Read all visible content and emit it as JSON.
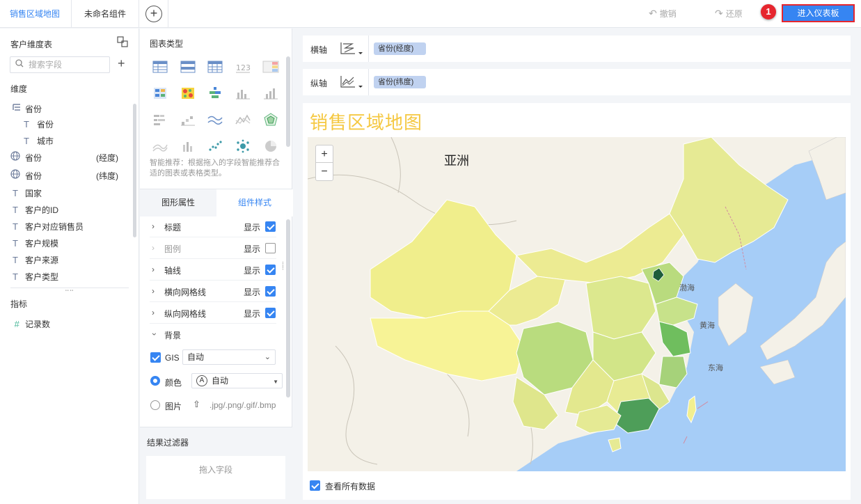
{
  "topbar": {
    "tabs": [
      {
        "label": "销售区域地图",
        "active": true
      },
      {
        "label": "未命名组件",
        "active": false
      }
    ],
    "add_tab_symbol": "+",
    "undo_label": "撤销",
    "redo_label": "还原",
    "step_badge": "1",
    "enter_dashboard_label": "进入仪表板"
  },
  "left_panel": {
    "table_name": "客户维度表",
    "search_placeholder": "搜索字段",
    "dimension_label": "维度",
    "dimensions": [
      {
        "icon": "tree-icon",
        "name": "省份",
        "suffix": ""
      },
      {
        "icon": "text-icon",
        "name": "省份",
        "suffix": ""
      },
      {
        "icon": "text-icon",
        "name": "城市",
        "suffix": ""
      },
      {
        "icon": "globe-icon",
        "name": "省份",
        "suffix": "(经度)"
      },
      {
        "icon": "globe-icon",
        "name": "省份",
        "suffix": "(纬度)"
      },
      {
        "icon": "text-icon",
        "name": "国家",
        "suffix": ""
      },
      {
        "icon": "text-icon",
        "name": "客户的ID",
        "suffix": ""
      },
      {
        "icon": "text-icon",
        "name": "客户对应销售员",
        "suffix": ""
      },
      {
        "icon": "text-icon",
        "name": "客户规模",
        "suffix": ""
      },
      {
        "icon": "text-icon",
        "name": "客户来源",
        "suffix": ""
      },
      {
        "icon": "text-icon",
        "name": "客户类型",
        "suffix": ""
      }
    ],
    "measure_label": "指标",
    "measures": [
      {
        "icon": "hash-icon",
        "name": "记录数"
      }
    ]
  },
  "middle_panel": {
    "chart_type_title": "图表类型",
    "smart_hint": "智能推荐：根据拖入的字段智能推荐合适的图表或表格类型。",
    "property_tabs": [
      "图形属性",
      "组件样式"
    ],
    "property_rows": [
      {
        "label": "标题",
        "state_label": "显示",
        "checked": true,
        "dim": false
      },
      {
        "label": "图例",
        "state_label": "显示",
        "checked": false,
        "dim": true
      },
      {
        "label": "轴线",
        "state_label": "显示",
        "checked": true,
        "dim": false
      },
      {
        "label": "横向网格线",
        "state_label": "显示",
        "checked": true,
        "dim": false
      },
      {
        "label": "纵向网格线",
        "state_label": "显示",
        "checked": true,
        "dim": false
      }
    ],
    "background": {
      "label": "背景",
      "gis_label": "GIS",
      "gis_value": "自动",
      "color_label": "颜色",
      "color_value": "自动",
      "image_label": "图片",
      "image_formats": ".jpg/.png/.gif/.bmp"
    },
    "filter_title": "结果过滤器",
    "filter_placeholder": "拖入字段"
  },
  "axes": {
    "x_label": "横轴",
    "x_field": "省份(经度)",
    "y_label": "纵轴",
    "y_field": "省份(纬度)"
  },
  "canvas": {
    "chart_title": "销售区域地图",
    "zoom_in": "+",
    "zoom_out": "−",
    "continent_label": "亚洲",
    "sea_labels": [
      "渤海",
      "黄海",
      "东海"
    ],
    "view_all_label": "查看所有数据",
    "view_all_checked": true
  },
  "colors": {
    "accent": "#3685f2",
    "title_yellow": "#f5c842",
    "highlight_red": "#e6262e"
  }
}
